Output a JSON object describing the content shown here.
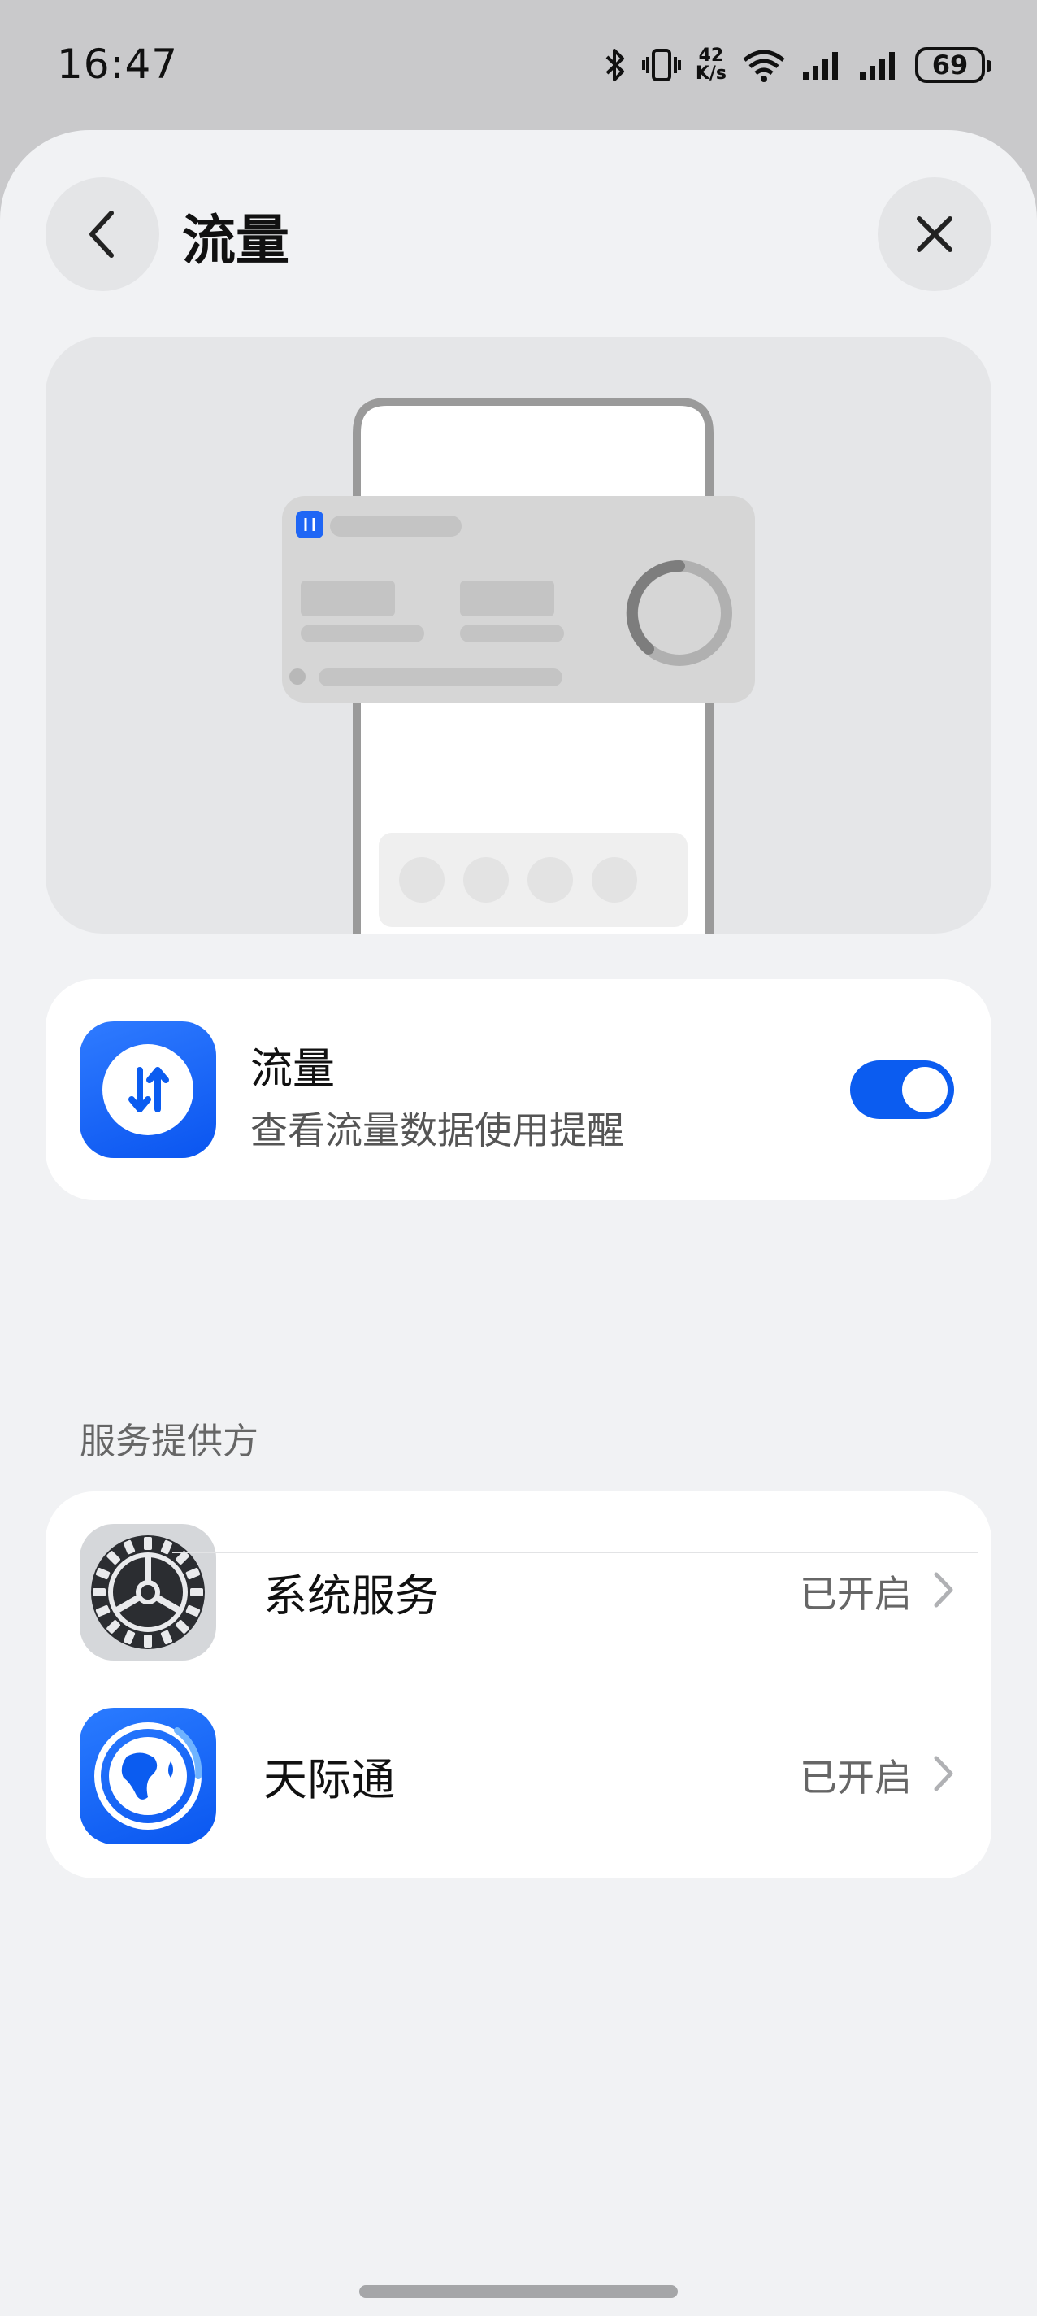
{
  "status_bar": {
    "time": "16:47",
    "net_speed_value": "42",
    "net_speed_unit": "K/s",
    "battery": "69"
  },
  "header": {
    "title": "流量",
    "back_icon": "chevron-left-icon",
    "close_icon": "close-icon"
  },
  "feature": {
    "title": "流量",
    "subtitle": "查看流量数据使用提醒",
    "enabled": true,
    "icon": "data-transfer-icon",
    "accent": "#0b5cf0"
  },
  "providers": {
    "section_title": "服务提供方",
    "items": [
      {
        "name": "系统服务",
        "status": "已开启",
        "icon": "settings-gear-icon"
      },
      {
        "name": "天际通",
        "status": "已开启",
        "icon": "globe-icon"
      }
    ]
  }
}
